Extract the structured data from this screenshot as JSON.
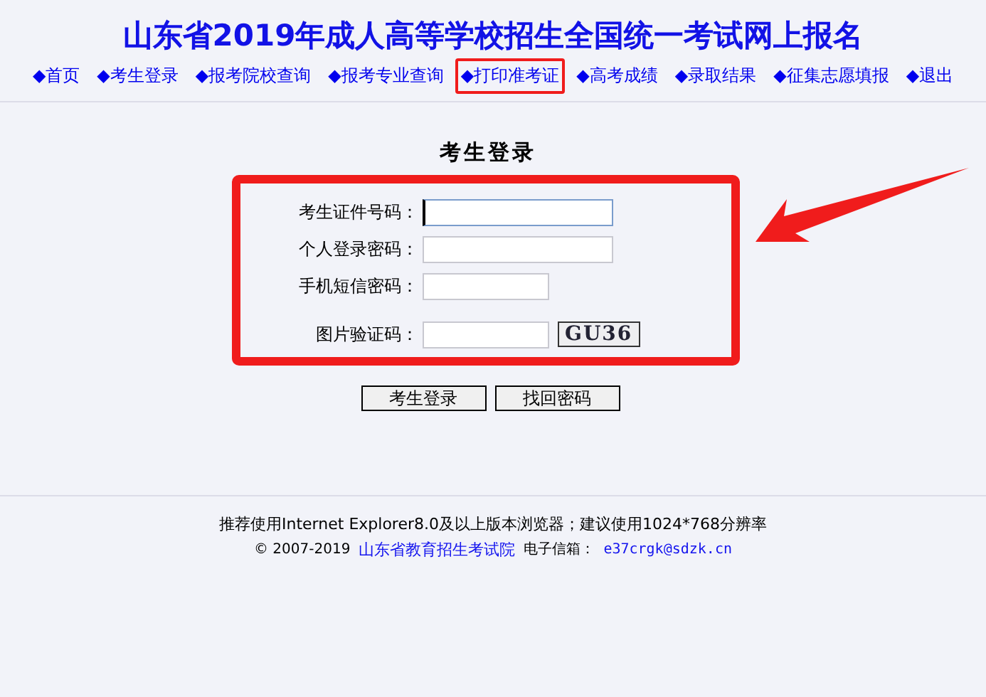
{
  "title": "山东省2019年成人高等学校招生全国统一考试网上报名",
  "nav": [
    {
      "label": "◆首页",
      "highlighted": false
    },
    {
      "label": "◆考生登录",
      "highlighted": false
    },
    {
      "label": "◆报考院校查询",
      "highlighted": false
    },
    {
      "label": "◆报考专业查询",
      "highlighted": false
    },
    {
      "label": "◆打印准考证",
      "highlighted": true
    },
    {
      "label": "◆高考成绩",
      "highlighted": false
    },
    {
      "label": "◆录取结果",
      "highlighted": false
    },
    {
      "label": "◆征集志愿填报",
      "highlighted": false
    },
    {
      "label": "◆退出",
      "highlighted": false
    }
  ],
  "form": {
    "heading": "考生登录",
    "highlighted": true,
    "fields": [
      {
        "label": "考生证件号码：",
        "kind": "long",
        "focused": true
      },
      {
        "label": "个人登录密码：",
        "kind": "long",
        "focused": false
      },
      {
        "label": "手机短信密码：",
        "kind": "short",
        "focused": false
      },
      {
        "label": "图片验证码：",
        "kind": "captcha",
        "focused": false,
        "captcha": "GU36"
      }
    ],
    "buttons": [
      "考生登录",
      "找回密码"
    ]
  },
  "footer": {
    "browser_note": "推荐使用Internet Explorer8.0及以上版本浏览器；建议使用1024*768分辨率",
    "copyright": "© 2007-2019",
    "org_link": "山东省教育招生考试院",
    "email_label": "电子信箱：",
    "email": "e37crgk@sdzk.cn"
  }
}
